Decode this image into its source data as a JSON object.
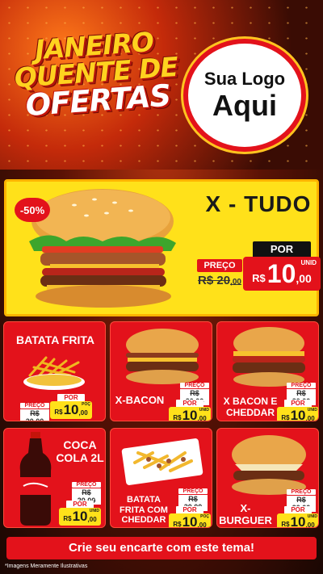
{
  "header": {
    "headline_line1": "JANEIRO",
    "headline_line2": "QUENTE DE",
    "headline_line3": "OFERTAS",
    "logo_line1": "Sua Logo",
    "logo_line2": "Aqui"
  },
  "featured": {
    "discount": "-50%",
    "name": "X - TUDO",
    "old_label": "PREÇO",
    "old_price_int": "R$ 20",
    "old_price_dec": ",00",
    "new_label": "POR",
    "currency": "R$",
    "new_price_int": "10",
    "new_price_dec": ",00",
    "unit": "UNID"
  },
  "products": [
    {
      "name": "BATATA FRITA",
      "old_label": "PREÇO",
      "old_price": "R$ 20,00",
      "new_label": "POR",
      "currency": "R$",
      "price_int": "10",
      "price_dec": ",00",
      "unit": "POÇ"
    },
    {
      "name": "X-BACON",
      "old_label": "PREÇO",
      "old_price": "R$ 20,00",
      "new_label": "POR",
      "currency": "R$",
      "price_int": "10",
      "price_dec": ",00",
      "unit": "UNID"
    },
    {
      "name": "X BACON E CHEDDAR",
      "old_label": "PREÇO",
      "old_price": "R$ 20,00",
      "new_label": "POR",
      "currency": "R$",
      "price_int": "10",
      "price_dec": ",00",
      "unit": "UNID"
    },
    {
      "name": "COCA COLA 2L",
      "old_label": "PREÇO",
      "old_price": "R$ 20,00",
      "new_label": "POR",
      "currency": "R$",
      "price_int": "10",
      "price_dec": ",00",
      "unit": "UNID"
    },
    {
      "name": "BATATA FRITA COM CHEDDAR",
      "old_label": "PREÇO",
      "old_price": "R$ 20,00",
      "new_label": "POR",
      "currency": "R$",
      "price_int": "10",
      "price_dec": ",00",
      "unit": "POÇ"
    },
    {
      "name": "X-BURGUER",
      "old_label": "PREÇO",
      "old_price": "R$ 20,00",
      "new_label": "POR",
      "currency": "R$",
      "price_int": "10",
      "price_dec": ",00",
      "unit": "UNID"
    }
  ],
  "cta": "Crie seu encarte com este tema!",
  "footnote": "*Imagens Meramente Ilustrativas",
  "colors": {
    "red": "#e3121b",
    "yellow": "#ffe11a",
    "dark": "#1a1a1a"
  }
}
